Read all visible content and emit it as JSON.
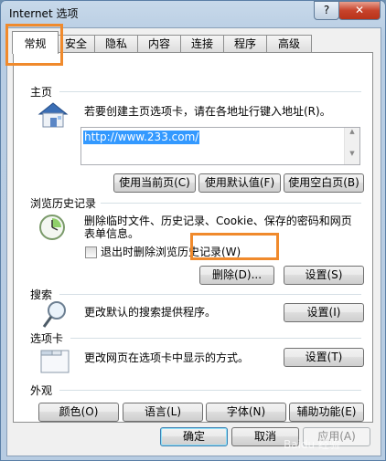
{
  "window": {
    "title": "Internet 选项",
    "help_label": "?",
    "close_label": "✕"
  },
  "tabs": [
    "常规",
    "安全",
    "隐私",
    "内容",
    "连接",
    "程序",
    "高级"
  ],
  "homepage": {
    "group_title": "主页",
    "description": "若要创建主页选项卡，请在各地址行键入地址(R)。",
    "url": "http://www.233.com/",
    "use_current": "使用当前页(C)",
    "use_default": "使用默认值(F)",
    "use_blank": "使用空白页(B)"
  },
  "history": {
    "group_title": "浏览历史记录",
    "description_line1": "删除临时文件、历史记录、Cookie、保存的密码和网页",
    "description_line2": "表单信息。",
    "checkbox_label": "退出时删除浏览历史记录(W)",
    "checkbox_checked": false,
    "delete_button": "删除(D)...",
    "settings_button": "设置(S)"
  },
  "search": {
    "group_title": "搜索",
    "description": "更改默认的搜索提供程序。",
    "settings_button": "设置(I)"
  },
  "tabs_group": {
    "group_title": "选项卡",
    "description": "更改网页在选项卡中显示的方式。",
    "settings_button": "设置(T)"
  },
  "appearance": {
    "group_title": "外观",
    "colors": "颜色(O)",
    "languages": "语言(L)",
    "fonts": "字体(N)",
    "accessibility": "辅助功能(E)"
  },
  "footer": {
    "ok": "确定",
    "cancel": "取消",
    "apply": "应用(A)"
  },
  "watermark": "Baidu 经验"
}
